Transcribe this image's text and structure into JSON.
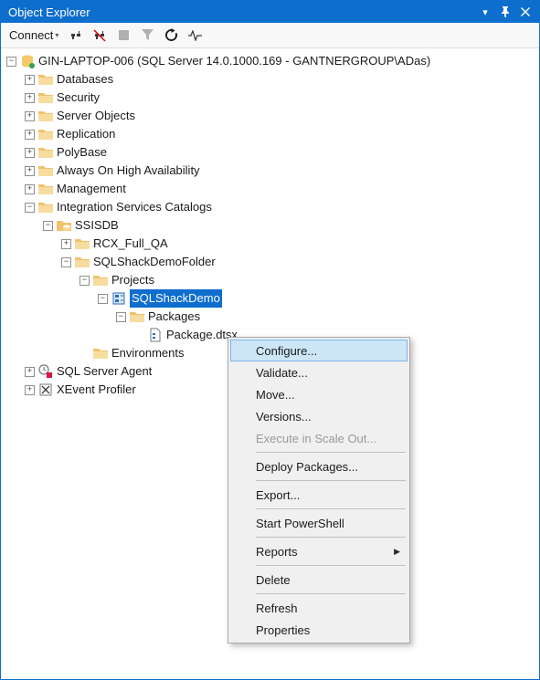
{
  "title_bar": {
    "title": "Object Explorer"
  },
  "toolbar": {
    "connect": "Connect"
  },
  "tree": {
    "server": "GIN-LAPTOP-006 (SQL Server 14.0.1000.169 - GANTNERGROUP\\ADas)",
    "databases": "Databases",
    "security": "Security",
    "server_objects": "Server Objects",
    "replication": "Replication",
    "polybase": "PolyBase",
    "always_on": "Always On High Availability",
    "management": "Management",
    "isc": "Integration Services Catalogs",
    "ssisdb": "SSISDB",
    "rcx": "RCX_Full_QA",
    "sqlshackfolder": "SQLShackDemoFolder",
    "projects": "Projects",
    "sqlshackdemo": "SQLShackDemo",
    "packages": "Packages",
    "packagedtsx": "Package.dtsx",
    "environments": "Environments",
    "sql_agent": "SQL Server Agent",
    "xevent": "XEvent Profiler"
  },
  "menu": {
    "configure": "Configure...",
    "validate": "Validate...",
    "move": "Move...",
    "versions": "Versions...",
    "execute_scale": "Execute in Scale Out...",
    "deploy": "Deploy Packages...",
    "export": "Export...",
    "powershell": "Start PowerShell",
    "reports": "Reports",
    "delete": "Delete",
    "refresh": "Refresh",
    "properties": "Properties"
  }
}
